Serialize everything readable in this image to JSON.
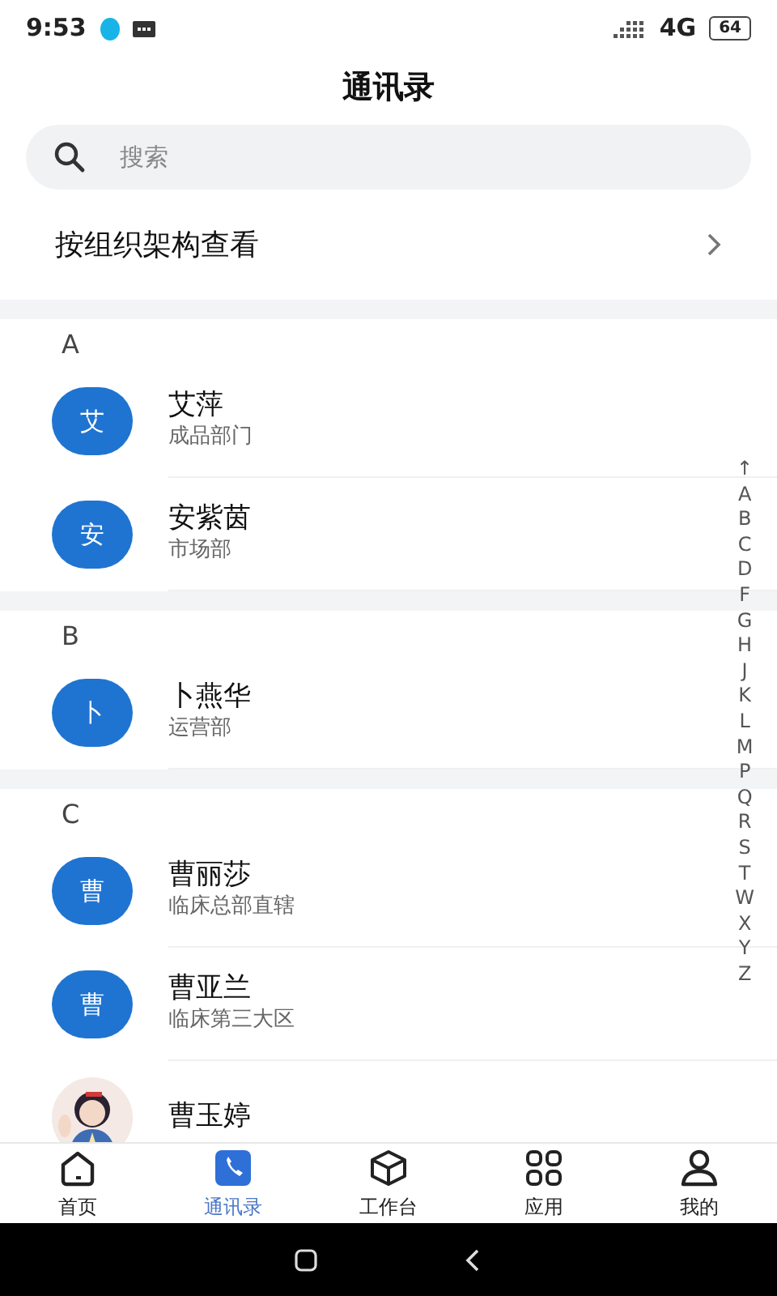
{
  "status_bar": {
    "time": "9:53",
    "network": "4G",
    "battery": "64"
  },
  "title": "通讯录",
  "search": {
    "placeholder": "搜索"
  },
  "org_link": {
    "label": "按组织架构查看"
  },
  "sections": [
    {
      "letter": "A",
      "contacts": [
        {
          "kind": "initial",
          "initial": "艾",
          "name": "艾萍",
          "department": "成品部门"
        },
        {
          "kind": "initial",
          "initial": "安",
          "name": "安紫茵",
          "department": "市场部"
        }
      ]
    },
    {
      "letter": "B",
      "contacts": [
        {
          "kind": "initial",
          "initial": "卜",
          "name": "卜燕华",
          "department": "运营部"
        }
      ]
    },
    {
      "letter": "C",
      "contacts": [
        {
          "kind": "initial",
          "initial": "曹",
          "name": "曹丽莎",
          "department": "临床总部直辖"
        },
        {
          "kind": "initial",
          "initial": "曹",
          "name": "曹亚兰",
          "department": "临床第三大区"
        },
        {
          "kind": "picture",
          "name": "曹玉婷"
        }
      ]
    }
  ],
  "index_letters": [
    "↑",
    "A",
    "B",
    "C",
    "D",
    "F",
    "G",
    "H",
    "J",
    "K",
    "L",
    "M",
    "P",
    "Q",
    "R",
    "S",
    "T",
    "W",
    "X",
    "Y",
    "Z"
  ],
  "tabs": [
    {
      "label": "首页",
      "selected": false
    },
    {
      "label": "通讯录",
      "selected": true
    },
    {
      "label": "工作台",
      "selected": false
    },
    {
      "label": "应用",
      "selected": false
    },
    {
      "label": "我的",
      "selected": false
    }
  ]
}
